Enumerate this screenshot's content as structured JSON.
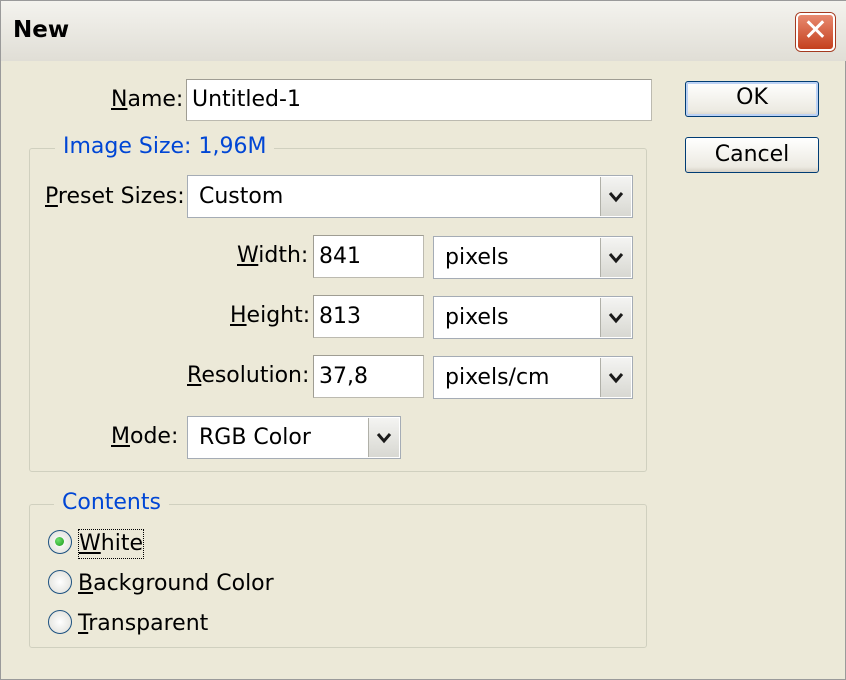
{
  "window": {
    "title": "New",
    "close_label": "✕"
  },
  "name_field": {
    "label_first": "N",
    "label_rest": "ame:",
    "value": "Untitled-1"
  },
  "image_size": {
    "legend": "Image Size: 1,96M",
    "preset": {
      "label_first": "P",
      "label_rest": "reset Sizes:",
      "value": "Custom"
    },
    "width": {
      "label_first": "W",
      "label_rest": "idth:",
      "value": "841",
      "unit": "pixels"
    },
    "height": {
      "label_first": "H",
      "label_rest": "eight:",
      "value": "813",
      "unit": "pixels"
    },
    "resolution": {
      "label_first": "R",
      "label_rest": "esolution:",
      "value": "37,8",
      "unit": "pixels/cm"
    },
    "mode": {
      "label_first": "M",
      "label_rest": "ode:",
      "value": "RGB Color"
    }
  },
  "contents": {
    "legend": "Contents",
    "options": [
      {
        "label_first": "W",
        "label_rest": "hite",
        "selected": true
      },
      {
        "label_first": "B",
        "label_rest": "ackground Color",
        "selected": false
      },
      {
        "label_first": "T",
        "label_rest": "ransparent",
        "selected": false
      }
    ]
  },
  "buttons": {
    "ok": "OK",
    "cancel": "Cancel"
  },
  "icons": {
    "dropdown": "chevron-down-icon",
    "close": "close-icon",
    "radio": "radio-button-icon"
  }
}
